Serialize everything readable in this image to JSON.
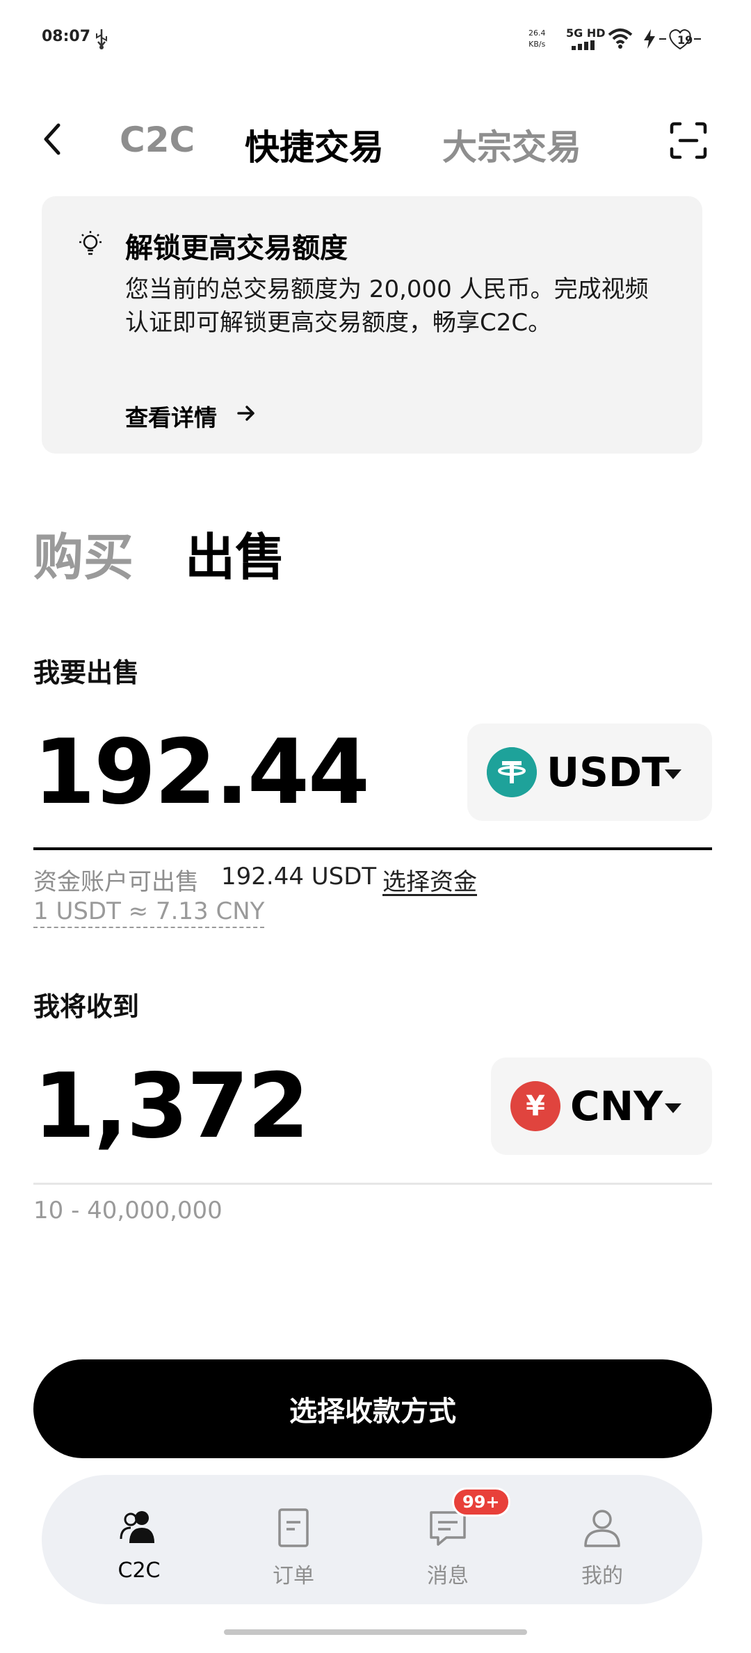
{
  "status_bar": {
    "time": "08:07",
    "net_speed_value": "26.4",
    "net_speed_unit": "KB/s",
    "network": "5G HD",
    "battery": "19"
  },
  "header": {
    "tabs": [
      {
        "label": "C2C",
        "active": false
      },
      {
        "label": "快捷交易",
        "active": true
      },
      {
        "label": "大宗交易",
        "active": false
      }
    ]
  },
  "banner": {
    "title": "解锁更高交易额度",
    "text": "您当前的总交易额度为 20,000 人民币。完成视频认证即可解锁更高交易额度，畅享C2C。",
    "link": "查看详情"
  },
  "mode": {
    "buy": "购买",
    "sell": "出售",
    "active": "sell"
  },
  "sell": {
    "label": "我要出售",
    "amount": "192.44",
    "currency": "USDT",
    "available_label": "资金账户可出售",
    "available_value": "192.44 USDT",
    "select_funds": "选择资金",
    "rate": "1 USDT ≈ 7.13 CNY"
  },
  "receive": {
    "label": "我将收到",
    "amount": "1,372",
    "currency": "CNY",
    "currency_symbol": "¥",
    "range": "10 - 40,000,000"
  },
  "cta": {
    "label": "选择收款方式"
  },
  "bottom_nav": {
    "items": [
      {
        "label": "C2C",
        "icon": "people-icon",
        "active": true
      },
      {
        "label": "订单",
        "icon": "order-icon",
        "active": false
      },
      {
        "label": "消息",
        "icon": "message-icon",
        "active": false,
        "badge": "99+"
      },
      {
        "label": "我的",
        "icon": "person-icon",
        "active": false
      }
    ]
  },
  "colors": {
    "usdt_coin": "#1ea29a",
    "cny_coin": "#e0443e",
    "badge": "#e8403a"
  }
}
